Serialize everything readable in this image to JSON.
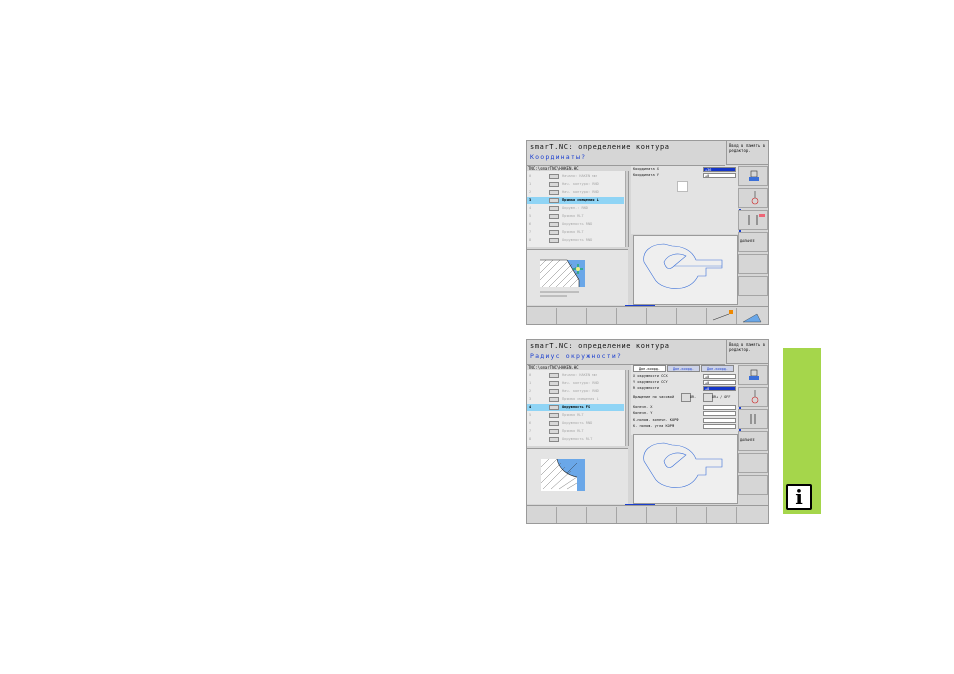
{
  "screen1": {
    "title": "smarT.NC: определение контура",
    "prompt": "Координаты?",
    "mode_label": "Ввод в память в редактор.",
    "path": "TNC:\\smarTNC\\HAKEN.HC",
    "tree_items": [
      {
        "num": "0",
        "label": "Начало: HAKEN мм"
      },
      {
        "num": "1",
        "label": "Нач. контура: RND"
      },
      {
        "num": "2",
        "label": "Нач. контура: RND"
      },
      {
        "num": "3",
        "label": "Прямая смещения L"
      },
      {
        "num": "4",
        "label": "Окружн.: RND"
      },
      {
        "num": "5",
        "label": "Прямая RLT"
      },
      {
        "num": "6",
        "label": "Окружность RND"
      },
      {
        "num": "7",
        "label": "Прямая RLT"
      },
      {
        "num": "8",
        "label": "Окружность RND"
      }
    ],
    "fields": [
      {
        "label": "Координата X",
        "value": "+36"
      },
      {
        "label": "Координата Y",
        "value": "+0"
      }
    ],
    "softkeys": [
      "",
      "",
      "",
      "ДАЛЬНЕЕ",
      "",
      ""
    ]
  },
  "screen2": {
    "title": "smarT.NC: определение контура",
    "prompt": "Радиус окружности?",
    "mode_label": "Ввод в память в редактор.",
    "path": "TNC:\\smarTNC\\HAKEN.HC",
    "tabs": [
      "Доп.коорд.",
      "Доп.коорд.",
      "Доп.коорд."
    ],
    "tree_items": [
      {
        "num": "0",
        "label": "Начало: HAKEN мм"
      },
      {
        "num": "1",
        "label": "Нач. контура: RND"
      },
      {
        "num": "2",
        "label": "Нач. контура: RND"
      },
      {
        "num": "3",
        "label": "Прямая смещения L"
      },
      {
        "num": "4",
        "label": "Окружность FS"
      },
      {
        "num": "5",
        "label": "Прямая RLT"
      },
      {
        "num": "6",
        "label": "Окружность RND"
      },
      {
        "num": "7",
        "label": "Прямая RLT"
      },
      {
        "num": "8",
        "label": "Окружность RLT"
      }
    ],
    "fields": [
      {
        "label": "X окружности CCX",
        "value": "+0"
      },
      {
        "label": "Y окружности CCY",
        "value": "+0"
      },
      {
        "label": "R окружности",
        "value": "+8"
      },
      {
        "label": "Вращение по часовой",
        "value": ""
      },
      {
        "label": "Конечн. X",
        "value": ""
      },
      {
        "label": "Конечн. Y",
        "value": ""
      },
      {
        "label": "К.полож. конечн. КОРФ",
        "value": ""
      },
      {
        "label": "К. полож. угла КОРФ",
        "value": ""
      }
    ],
    "rotation_options": [
      "DR-",
      "DR+ / OFF"
    ],
    "softkeys": [
      "",
      "",
      "",
      "ДАЛЬНЕЕ",
      "",
      ""
    ]
  },
  "side_tab": {
    "icon": "info-icon",
    "glyph": "i",
    "color": "#a5d64b"
  }
}
